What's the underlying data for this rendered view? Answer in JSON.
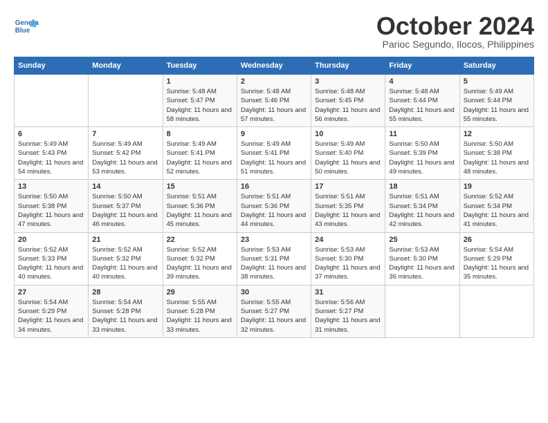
{
  "header": {
    "logo_line1": "General",
    "logo_line2": "Blue",
    "month": "October 2024",
    "location": "Parioc Segundo, Ilocos, Philippines"
  },
  "weekdays": [
    "Sunday",
    "Monday",
    "Tuesday",
    "Wednesday",
    "Thursday",
    "Friday",
    "Saturday"
  ],
  "weeks": [
    [
      {
        "day": "",
        "info": ""
      },
      {
        "day": "",
        "info": ""
      },
      {
        "day": "1",
        "info": "Sunrise: 5:48 AM\nSunset: 5:47 PM\nDaylight: 11 hours and 58 minutes."
      },
      {
        "day": "2",
        "info": "Sunrise: 5:48 AM\nSunset: 5:46 PM\nDaylight: 11 hours and 57 minutes."
      },
      {
        "day": "3",
        "info": "Sunrise: 5:48 AM\nSunset: 5:45 PM\nDaylight: 11 hours and 56 minutes."
      },
      {
        "day": "4",
        "info": "Sunrise: 5:48 AM\nSunset: 5:44 PM\nDaylight: 11 hours and 55 minutes."
      },
      {
        "day": "5",
        "info": "Sunrise: 5:49 AM\nSunset: 5:44 PM\nDaylight: 11 hours and 55 minutes."
      }
    ],
    [
      {
        "day": "6",
        "info": "Sunrise: 5:49 AM\nSunset: 5:43 PM\nDaylight: 11 hours and 54 minutes."
      },
      {
        "day": "7",
        "info": "Sunrise: 5:49 AM\nSunset: 5:42 PM\nDaylight: 11 hours and 53 minutes."
      },
      {
        "day": "8",
        "info": "Sunrise: 5:49 AM\nSunset: 5:41 PM\nDaylight: 11 hours and 52 minutes."
      },
      {
        "day": "9",
        "info": "Sunrise: 5:49 AM\nSunset: 5:41 PM\nDaylight: 11 hours and 51 minutes."
      },
      {
        "day": "10",
        "info": "Sunrise: 5:49 AM\nSunset: 5:40 PM\nDaylight: 11 hours and 50 minutes."
      },
      {
        "day": "11",
        "info": "Sunrise: 5:50 AM\nSunset: 5:39 PM\nDaylight: 11 hours and 49 minutes."
      },
      {
        "day": "12",
        "info": "Sunrise: 5:50 AM\nSunset: 5:38 PM\nDaylight: 11 hours and 48 minutes."
      }
    ],
    [
      {
        "day": "13",
        "info": "Sunrise: 5:50 AM\nSunset: 5:38 PM\nDaylight: 11 hours and 47 minutes."
      },
      {
        "day": "14",
        "info": "Sunrise: 5:50 AM\nSunset: 5:37 PM\nDaylight: 11 hours and 46 minutes."
      },
      {
        "day": "15",
        "info": "Sunrise: 5:51 AM\nSunset: 5:36 PM\nDaylight: 11 hours and 45 minutes."
      },
      {
        "day": "16",
        "info": "Sunrise: 5:51 AM\nSunset: 5:36 PM\nDaylight: 11 hours and 44 minutes."
      },
      {
        "day": "17",
        "info": "Sunrise: 5:51 AM\nSunset: 5:35 PM\nDaylight: 11 hours and 43 minutes."
      },
      {
        "day": "18",
        "info": "Sunrise: 5:51 AM\nSunset: 5:34 PM\nDaylight: 11 hours and 42 minutes."
      },
      {
        "day": "19",
        "info": "Sunrise: 5:52 AM\nSunset: 5:34 PM\nDaylight: 11 hours and 41 minutes."
      }
    ],
    [
      {
        "day": "20",
        "info": "Sunrise: 5:52 AM\nSunset: 5:33 PM\nDaylight: 11 hours and 40 minutes."
      },
      {
        "day": "21",
        "info": "Sunrise: 5:52 AM\nSunset: 5:32 PM\nDaylight: 11 hours and 40 minutes."
      },
      {
        "day": "22",
        "info": "Sunrise: 5:52 AM\nSunset: 5:32 PM\nDaylight: 11 hours and 39 minutes."
      },
      {
        "day": "23",
        "info": "Sunrise: 5:53 AM\nSunset: 5:31 PM\nDaylight: 11 hours and 38 minutes."
      },
      {
        "day": "24",
        "info": "Sunrise: 5:53 AM\nSunset: 5:30 PM\nDaylight: 11 hours and 37 minutes."
      },
      {
        "day": "25",
        "info": "Sunrise: 5:53 AM\nSunset: 5:30 PM\nDaylight: 11 hours and 36 minutes."
      },
      {
        "day": "26",
        "info": "Sunrise: 5:54 AM\nSunset: 5:29 PM\nDaylight: 11 hours and 35 minutes."
      }
    ],
    [
      {
        "day": "27",
        "info": "Sunrise: 5:54 AM\nSunset: 5:29 PM\nDaylight: 11 hours and 34 minutes."
      },
      {
        "day": "28",
        "info": "Sunrise: 5:54 AM\nSunset: 5:28 PM\nDaylight: 11 hours and 33 minutes."
      },
      {
        "day": "29",
        "info": "Sunrise: 5:55 AM\nSunset: 5:28 PM\nDaylight: 11 hours and 33 minutes."
      },
      {
        "day": "30",
        "info": "Sunrise: 5:55 AM\nSunset: 5:27 PM\nDaylight: 11 hours and 32 minutes."
      },
      {
        "day": "31",
        "info": "Sunrise: 5:56 AM\nSunset: 5:27 PM\nDaylight: 11 hours and 31 minutes."
      },
      {
        "day": "",
        "info": ""
      },
      {
        "day": "",
        "info": ""
      }
    ]
  ]
}
